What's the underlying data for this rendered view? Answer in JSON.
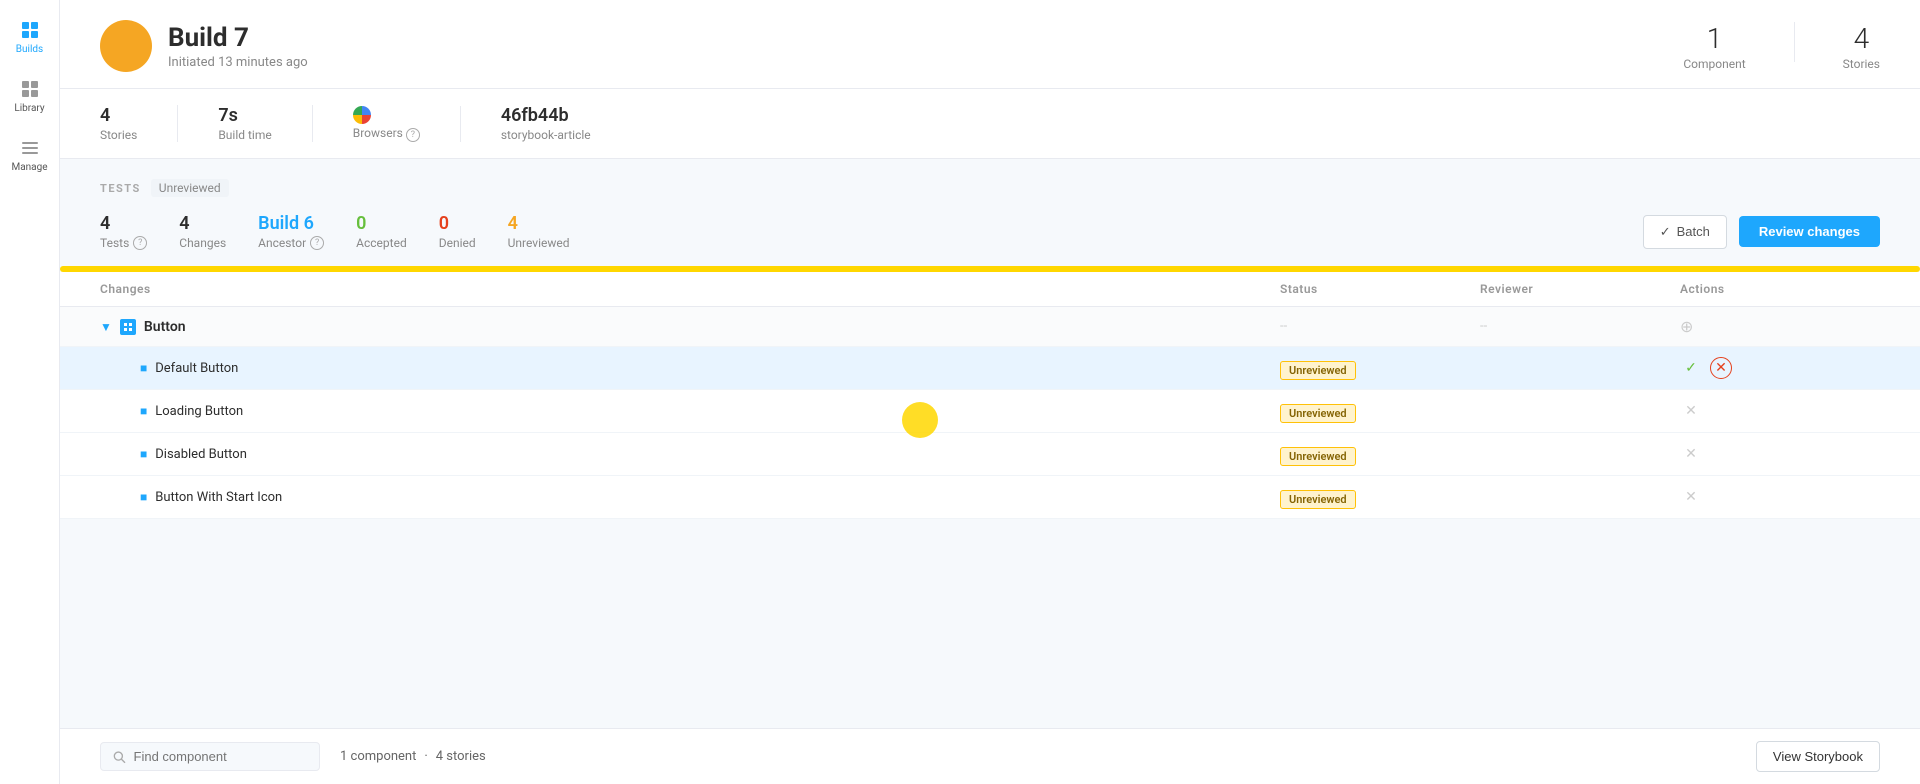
{
  "sidebar": {
    "items": [
      {
        "id": "builds",
        "label": "Builds",
        "active": true
      },
      {
        "id": "library",
        "label": "Library",
        "active": false
      },
      {
        "id": "manage",
        "label": "Manage",
        "active": false
      }
    ]
  },
  "header": {
    "build_number": "Build 7",
    "subtitle": "Initiated 13 minutes ago",
    "component_count": "1",
    "component_label": "Component",
    "stories_count": "4",
    "stories_label": "Stories"
  },
  "stats": {
    "stories": {
      "value": "4",
      "label": "Stories"
    },
    "build_time": {
      "value": "7s",
      "label": "Build time"
    },
    "browsers": {
      "value": "Browsers",
      "label": "Browsers",
      "has_icon": true
    },
    "commit": {
      "value": "46fb44b",
      "label": "storybook-article"
    }
  },
  "tests": {
    "section_title": "TESTS",
    "filter_label": "Unreviewed",
    "stats": {
      "tests": {
        "value": "4",
        "label": "Tests",
        "has_info": true
      },
      "changes": {
        "value": "4",
        "label": "Changes"
      },
      "ancestor": {
        "value": "Build 6",
        "label": "Ancestor",
        "has_info": true
      },
      "accepted": {
        "value": "0",
        "label": "Accepted"
      },
      "denied": {
        "value": "0",
        "label": "Denied"
      },
      "unreviewed": {
        "value": "4",
        "label": "Unreviewed"
      }
    },
    "batch_label": "Batch",
    "review_label": "Review changes"
  },
  "table": {
    "headers": {
      "changes": "Changes",
      "status": "Status",
      "reviewer": "Reviewer",
      "actions": "Actions"
    },
    "rows": [
      {
        "type": "group",
        "name": "Button",
        "status": "--",
        "reviewer": "--",
        "actions": ""
      },
      {
        "type": "story",
        "name": "Default Button",
        "status": "Unreviewed",
        "reviewer": "",
        "actions": "accept-reject",
        "highlighted": true
      },
      {
        "type": "story",
        "name": "Loading Button",
        "status": "Unreviewed",
        "reviewer": "",
        "actions": "reject"
      },
      {
        "type": "story",
        "name": "Disabled Button",
        "status": "Unreviewed",
        "reviewer": "",
        "actions": "reject"
      },
      {
        "type": "story",
        "name": "Button With Start Icon",
        "status": "Unreviewed",
        "reviewer": "",
        "actions": "reject"
      }
    ]
  },
  "bottom_bar": {
    "search_placeholder": "Find component",
    "component_count": "1 component",
    "stories_count": "4 stories",
    "view_storybook_label": "View Storybook"
  }
}
